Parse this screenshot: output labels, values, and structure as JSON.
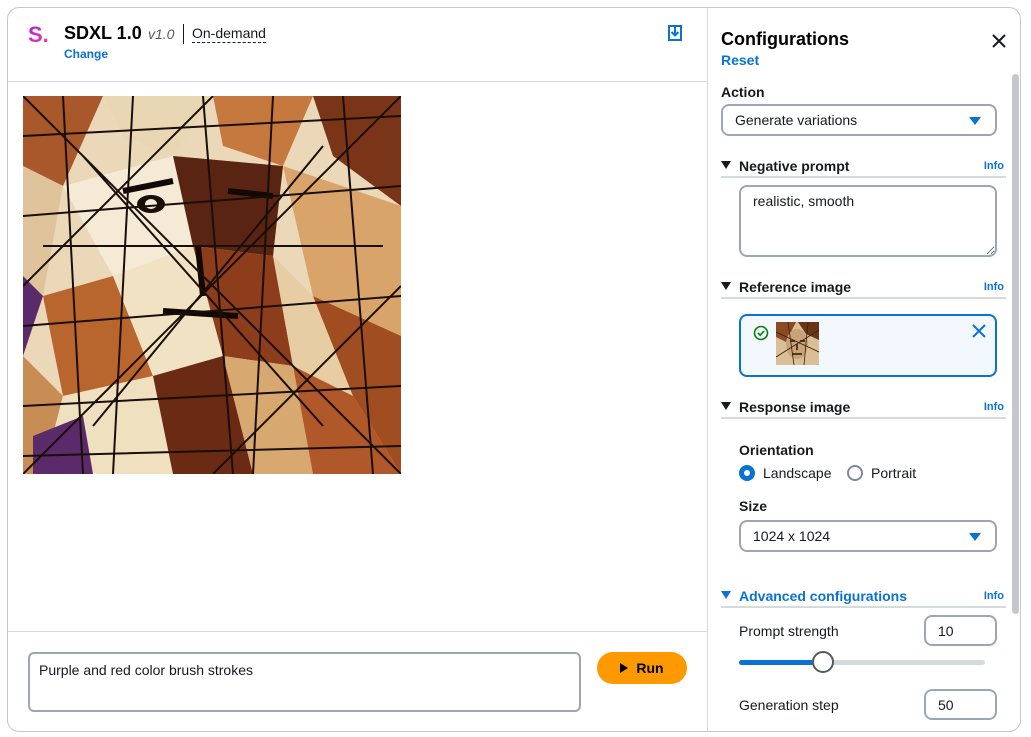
{
  "header": {
    "logo_glyph": "S.",
    "model_name": "SDXL 1.0",
    "version": "v1.0",
    "mode": "On-demand",
    "change_label": "Change",
    "download_icon": "download-icon"
  },
  "prompt": {
    "value": "Purple and red color brush strokes",
    "run_label": "Run"
  },
  "config": {
    "title": "Configurations",
    "reset_label": "Reset",
    "action": {
      "label": "Action",
      "selected": "Generate variations"
    },
    "negative_prompt": {
      "label": "Negative prompt",
      "info": "Info",
      "value": "realistic, smooth"
    },
    "reference_image": {
      "label": "Reference image",
      "info": "Info"
    },
    "response_image": {
      "label": "Response image",
      "info": "Info",
      "orientation_label": "Orientation",
      "orientation_options": [
        "Landscape",
        "Portrait"
      ],
      "orientation_selected": "Landscape",
      "size_label": "Size",
      "size_selected": "1024 x 1024"
    },
    "advanced": {
      "label": "Advanced configurations",
      "info": "Info",
      "prompt_strength_label": "Prompt strength",
      "prompt_strength_value": "10",
      "prompt_strength_fraction": 0.34,
      "generation_step_label": "Generation step",
      "generation_step_value": "50"
    }
  },
  "colors": {
    "accent": "#0972d3",
    "run_button": "#ff9900",
    "success": "#037f0c"
  }
}
